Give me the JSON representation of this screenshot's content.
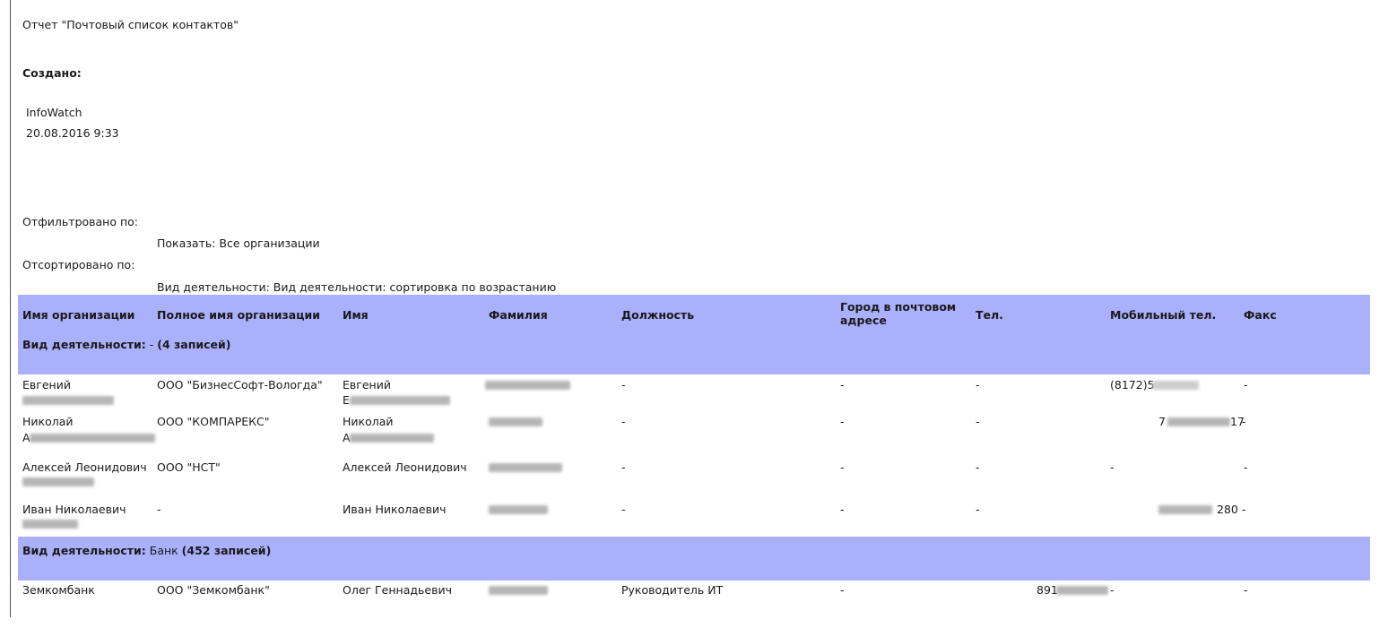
{
  "report": {
    "title": "Отчет \"Почтовый список контактов\"",
    "created_label": "Создано:",
    "created_by": "InfoWatch",
    "created_at": "20.08.2016 9:33",
    "filtered_label": "Отфильтровано по:",
    "filter_value": "Показать: Все организации",
    "sorted_label": "Отсортировано по:",
    "sort_value": "Вид деятельности: Вид деятельности: сортировка по возрастанию"
  },
  "table": {
    "columns": [
      "Имя организации",
      "Полное имя организации",
      "Имя",
      "Фамилия",
      "Должность",
      "Город в почтовом адресе",
      "Тел.",
      "Мобильный тел.",
      "Факс"
    ],
    "groups": [
      {
        "label_bold": "Вид деятельности:",
        "label_value": " - ",
        "label_count": "(4 записей)",
        "rows": [
          {
            "org": "Евгений",
            "full_org": "ООО \"БизнесСофт-Вологда\"",
            "first": "Евгений",
            "first_line2": "Е",
            "job": "-",
            "city": "-",
            "phone": "-",
            "mobile": "(8172)5",
            "fax": "-"
          },
          {
            "org": "Николай",
            "org_line2": "А",
            "full_org": "ООО \"КОМПАРЕКС\"",
            "first": "Николай",
            "first_line2": "А",
            "job": "-",
            "city": "-",
            "phone": "-",
            "mobile": "7",
            "mobile_tail": "17",
            "fax": "-"
          },
          {
            "org": "Алексей Леонидович",
            "full_org": "ООО \"НСТ\"",
            "first": "Алексей Леонидович",
            "job": "-",
            "city": "-",
            "phone": "-",
            "mobile": "-",
            "fax": "-"
          },
          {
            "org": "Иван Николаевич",
            "full_org": "-",
            "first": "Иван Николаевич",
            "job": "-",
            "city": "-",
            "phone": "-",
            "mobile_tail": "280",
            "fax": "-"
          }
        ]
      },
      {
        "label_bold": "Вид деятельности:",
        "label_value": " Банк ",
        "label_count": "(452 записей)",
        "rows": [
          {
            "org": "Земкомбанк",
            "full_org": "ООО \"Земкомбанк\"",
            "first": "Олег Геннадьевич",
            "job": "Руководитель ИТ",
            "city": "-",
            "phone": "891",
            "phone_tail": "-",
            "fax": "-"
          }
        ]
      }
    ]
  }
}
